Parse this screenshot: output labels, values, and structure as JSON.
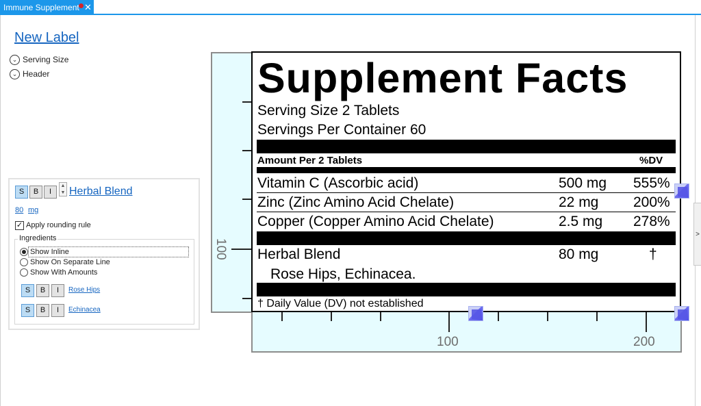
{
  "tab": {
    "title": "Immune Supplement",
    "close_glyph": "✕"
  },
  "editor": {
    "label_name": "New Label",
    "sections": [
      {
        "label": "Serving Size",
        "icon": "chevron-down-circle-icon"
      },
      {
        "label": "Header",
        "icon": "chevron-down-circle-icon"
      }
    ],
    "ingredient": {
      "format_buttons": [
        "S",
        "B",
        "I"
      ],
      "name": "Herbal Blend",
      "amount": "80",
      "unit": "mg",
      "apply_rounding_label": "Apply rounding rule",
      "apply_rounding_checked": true,
      "ingredients_group_label": "Ingredients",
      "display_options": [
        "Show Inline",
        "Show On Separate Line",
        "Show With Amounts"
      ],
      "selected_option": "Show Inline",
      "sub_ingredients": [
        {
          "name": "Rose Hips",
          "format_buttons": [
            "S",
            "B",
            "I"
          ]
        },
        {
          "name": "Echinacea",
          "format_buttons": [
            "S",
            "B",
            "I"
          ]
        }
      ]
    },
    "side_toggle_glyph": ">"
  },
  "rulers": {
    "left_label": "100",
    "bottom_labels": [
      "100",
      "200"
    ]
  },
  "label": {
    "title": "Supplement Facts",
    "serving_size": "Serving Size 2 Tablets",
    "servings_per_container": "Servings Per Container 60",
    "amount_header": "Amount Per 2 Tablets",
    "dv_header": "%DV",
    "rows": [
      {
        "name": "Vitamin C (Ascorbic acid)",
        "amount": "500 mg",
        "dv": "555%"
      },
      {
        "name": "Zinc (Zinc Amino Acid Chelate)",
        "amount": "22 mg",
        "dv": "200%"
      },
      {
        "name": "Copper (Copper Amino Acid Chelate)",
        "amount": "2.5 mg",
        "dv": "278%"
      }
    ],
    "blend": {
      "name": "Herbal Blend",
      "amount": "80 mg",
      "dv": "†",
      "ingredients": "Rose Hips, Echinacea."
    },
    "footnote": "† Daily Value (DV) not established"
  },
  "colors": {
    "accent": "#1c97ea",
    "link": "#1565c0",
    "ruler_bg": "#e6fcff",
    "handle": "#5656e6",
    "modified_dot": "#d4242a"
  }
}
